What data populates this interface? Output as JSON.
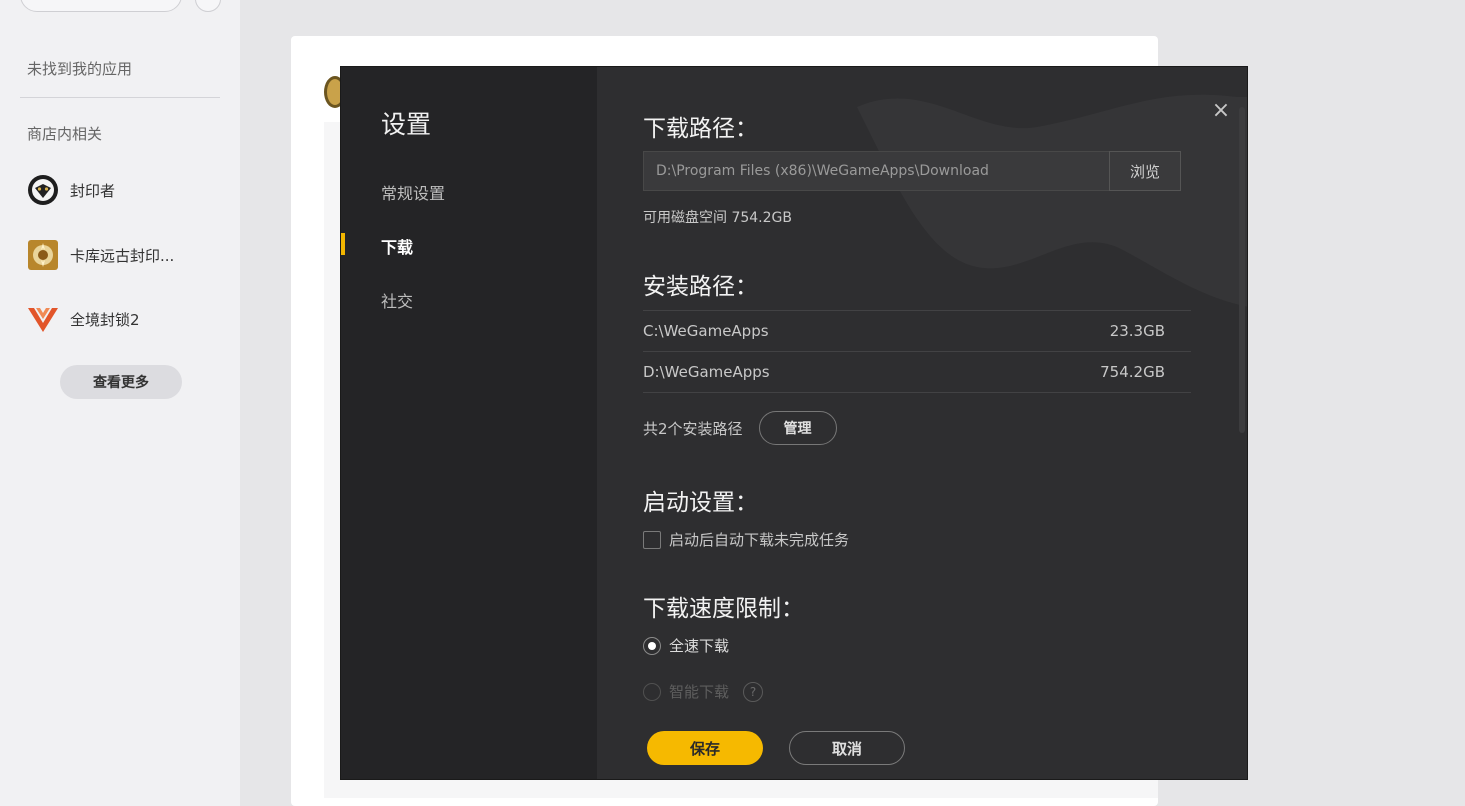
{
  "sidebar": {
    "not_found_label": "未找到我的应用",
    "store_related_label": "商店内相关",
    "apps": [
      {
        "name": "封印者"
      },
      {
        "name": "卡库远古封印..."
      },
      {
        "name": "全境封锁2"
      }
    ],
    "view_more_label": "查看更多"
  },
  "dialog": {
    "title": "设置",
    "nav": [
      {
        "label": "常规设置"
      },
      {
        "label": "下载"
      },
      {
        "label": "社交"
      }
    ],
    "active_nav": "下载",
    "close_symbol": "×",
    "download_path": {
      "title": "下载路径：",
      "value": "D:\\Program Files (x86)\\WeGameApps\\Download",
      "browse_label": "浏览",
      "disk_space": "可用磁盘空间 754.2GB"
    },
    "install_path": {
      "title": "安装路径：",
      "rows": [
        {
          "path": "C:\\WeGameApps",
          "size": "23.3GB"
        },
        {
          "path": "D:\\WeGameApps",
          "size": "754.2GB"
        }
      ],
      "count_label": "共2个安装路径",
      "manage_label": "管理"
    },
    "startup": {
      "title": "启动设置：",
      "auto_download_label": "启动后自动下载未完成任务",
      "auto_download_checked": false
    },
    "speed_limit": {
      "title": "下载速度限制：",
      "options": [
        {
          "label": "全速下载",
          "selected": true
        },
        {
          "label": "智能下载",
          "selected": false
        }
      ],
      "help_symbol": "?"
    },
    "save_label": "保存",
    "cancel_label": "取消",
    "accent_color": "#f6b900"
  }
}
